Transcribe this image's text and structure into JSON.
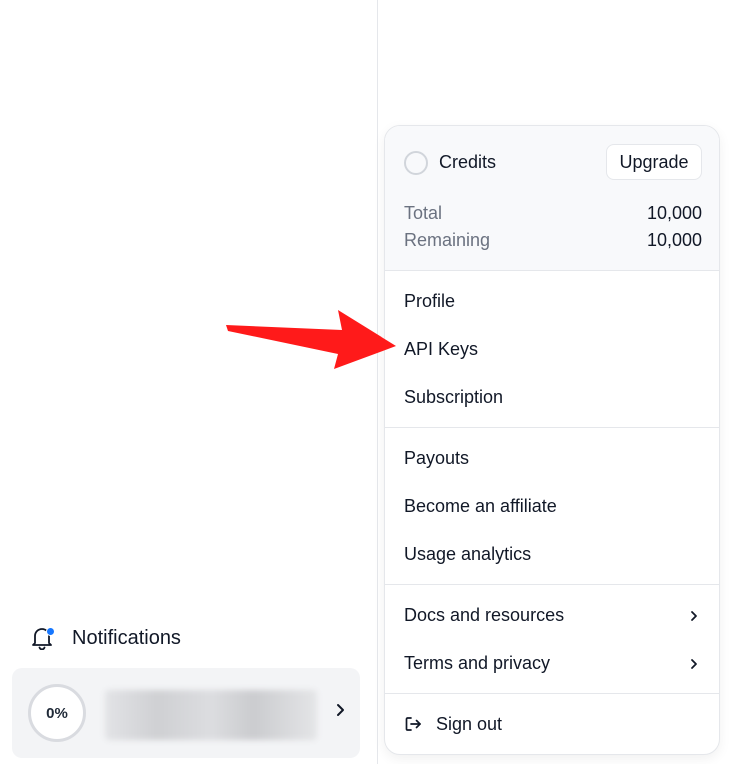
{
  "sidebar": {
    "notifications_label": "Notifications",
    "usage_percent": "0%"
  },
  "menu": {
    "credits": {
      "title": "Credits",
      "upgrade_label": "Upgrade",
      "total_label": "Total",
      "total_value": "10,000",
      "remaining_label": "Remaining",
      "remaining_value": "10,000"
    },
    "group1": [
      {
        "label": "Profile"
      },
      {
        "label": "API Keys"
      },
      {
        "label": "Subscription"
      }
    ],
    "group2": [
      {
        "label": "Payouts"
      },
      {
        "label": "Become an affiliate"
      },
      {
        "label": "Usage analytics"
      }
    ],
    "group3": [
      {
        "label": "Docs and resources"
      },
      {
        "label": "Terms and privacy"
      }
    ],
    "sign_out_label": "Sign out"
  },
  "annotation": {
    "arrow_color": "#ff1a1a",
    "points_to": "API Keys"
  },
  "colors": {
    "notification_dot": "#1677ff"
  }
}
